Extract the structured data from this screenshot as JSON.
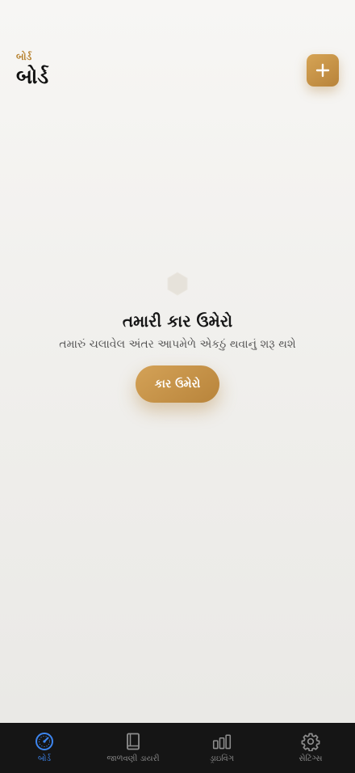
{
  "header": {
    "subtitle": "બોર્ડ",
    "title": "બોર્ડ",
    "add_icon": "plus-icon"
  },
  "empty_state": {
    "icon": "hexagon-icon",
    "title": "તમારી કાર ઉમેરો",
    "description": "તમારું ચલાવેલ અંતર આપમેળે એકઠું થવાનું શરૂ થશે",
    "cta_label": "કાર ઉમેરો"
  },
  "tabbar": {
    "items": [
      {
        "label": "બોર્ડ",
        "icon": "speedometer-icon",
        "active": true
      },
      {
        "label": "જાળવણી ડાયરી",
        "icon": "book-icon",
        "active": false
      },
      {
        "label": "ડ્રાઇવિંગ",
        "icon": "bar-chart-icon",
        "active": false
      },
      {
        "label": "સેટિંગ્સ",
        "icon": "gear-icon",
        "active": false
      }
    ]
  },
  "colors": {
    "accent": "#c08f45",
    "active_tab": "#3d86f0",
    "tabbar_bg": "#151515"
  }
}
